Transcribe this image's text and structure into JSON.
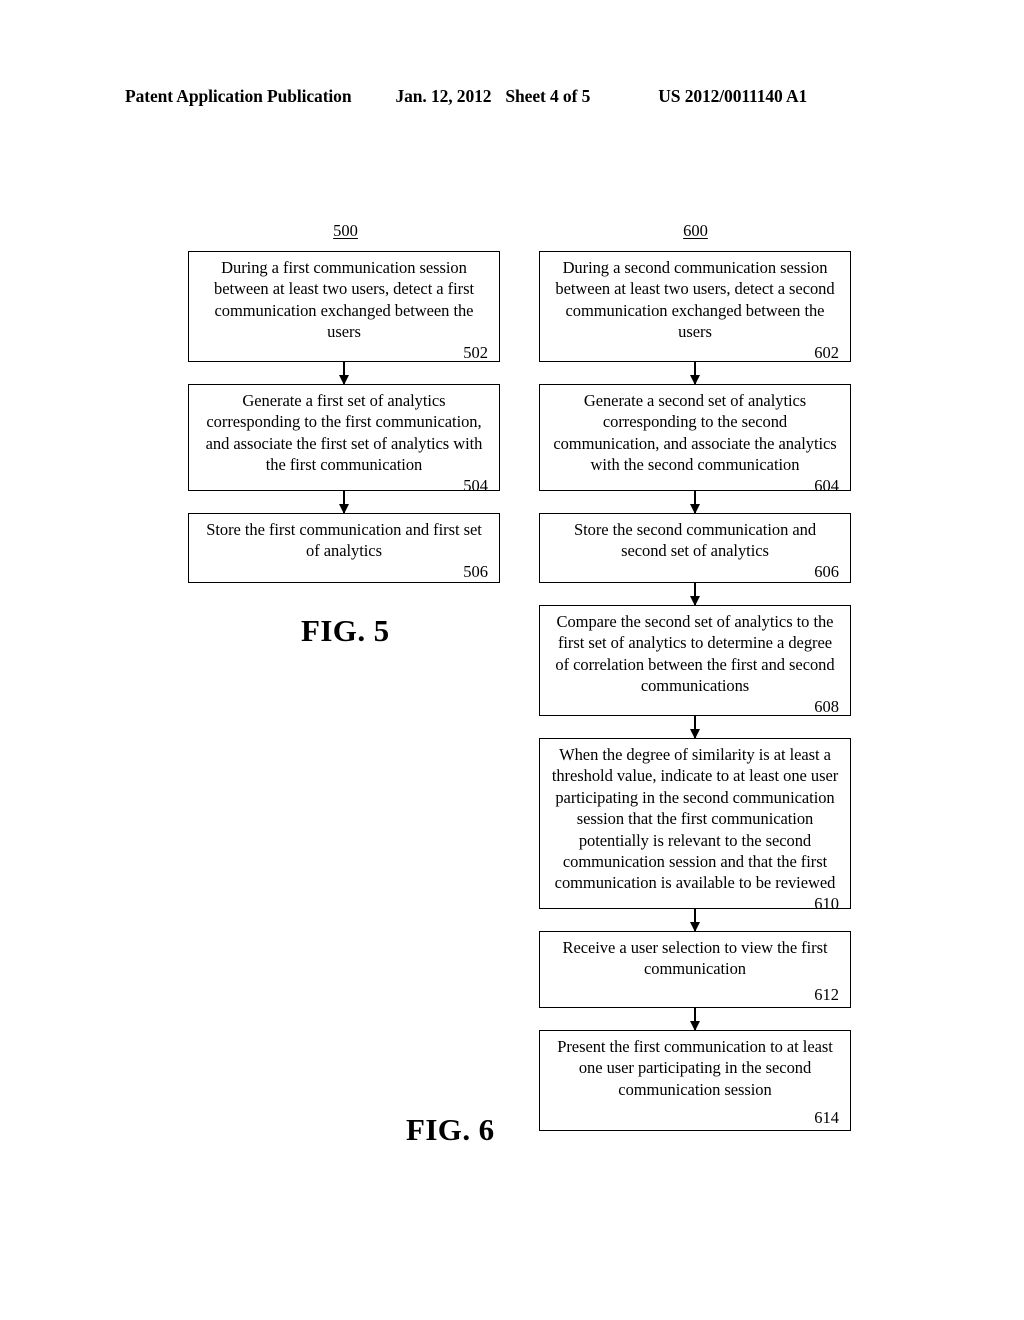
{
  "header": {
    "publication": "Patent Application Publication",
    "date": "Jan. 12, 2012",
    "sheet": "Sheet 4 of 5",
    "patent_number": "US 2012/0011140 A1"
  },
  "figures": [
    {
      "caption": "FIG. 5",
      "ref_label": "500",
      "steps": [
        {
          "ref": "502",
          "text": "During a first communication session between at least two users, detect a first communication exchanged between the users"
        },
        {
          "ref": "504",
          "text": "Generate a first set of analytics corresponding to the first communication, and associate the first set of analytics with the first communication"
        },
        {
          "ref": "506",
          "text": "Store the first communication and first set of analytics"
        }
      ]
    },
    {
      "caption": "FIG. 6",
      "ref_label": "600",
      "steps": [
        {
          "ref": "602",
          "text": "During a second communication session between at least two users, detect a second communication exchanged between the users"
        },
        {
          "ref": "604",
          "text": "Generate a second set of analytics corresponding to the second communication, and associate the analytics with the second communication"
        },
        {
          "ref": "606",
          "text": "Store the second communication and second set of analytics"
        },
        {
          "ref": "608",
          "text": "Compare the second set of analytics to the first set of analytics to determine a degree of correlation between the first and second communications"
        },
        {
          "ref": "610",
          "text": "When the degree of similarity is at least a threshold value, indicate to at least one user participating in the second communication session that the first communication potentially is relevant to the second communication session and that the first communication is available to be reviewed"
        },
        {
          "ref": "612",
          "text": "Receive a user selection to view the first communication"
        },
        {
          "ref": "614",
          "text": "Present the first communication to at least one user participating in the second communication session"
        }
      ]
    }
  ]
}
